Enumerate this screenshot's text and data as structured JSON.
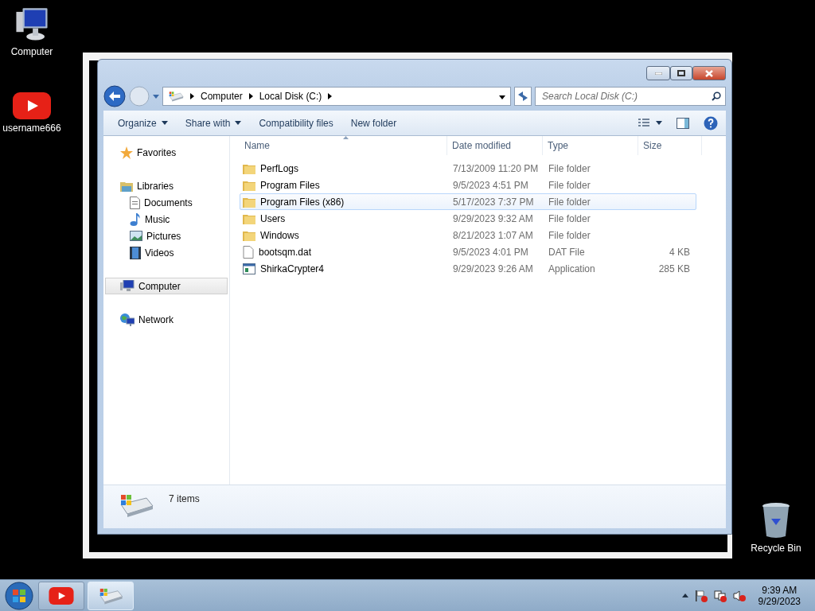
{
  "desktop_icons": [
    {
      "label": "Computer",
      "kind": "computer"
    },
    {
      "label": "username666",
      "kind": "youtube"
    },
    {
      "label": "Recycle Bin",
      "kind": "recycle"
    }
  ],
  "window": {
    "address": {
      "segments": [
        "Computer",
        "Local Disk (C:)"
      ]
    },
    "search": {
      "placeholder": "Search Local Disk (C:)"
    },
    "toolbar": [
      {
        "label": "Organize",
        "dropdown": true
      },
      {
        "label": "Share with",
        "dropdown": true
      },
      {
        "label": "Compatibility files",
        "dropdown": false
      },
      {
        "label": "New folder",
        "dropdown": false
      }
    ],
    "navigation": [
      {
        "label": "Favorites",
        "kind": "star",
        "selected": false
      },
      {
        "label": "Libraries",
        "kind": "library",
        "selected": false,
        "children": [
          {
            "label": "Documents",
            "kind": "document",
            "selected": false
          },
          {
            "label": "Music",
            "kind": "music",
            "selected": false
          },
          {
            "label": "Pictures",
            "kind": "pictures",
            "selected": false
          },
          {
            "label": "Videos",
            "kind": "videos",
            "selected": false
          }
        ]
      },
      {
        "label": "Computer",
        "kind": "computer",
        "selected": true
      },
      {
        "label": "Network",
        "kind": "network",
        "selected": false
      }
    ],
    "columns": [
      {
        "label": "Name",
        "sorted": true
      },
      {
        "label": "Date modified",
        "sorted": false
      },
      {
        "label": "Type",
        "sorted": false
      },
      {
        "label": "Size",
        "sorted": false
      }
    ],
    "rows": [
      {
        "name": "PerfLogs",
        "date": "7/13/2009 11:20 PM",
        "type": "File folder",
        "kind": "folder",
        "hovered": false
      },
      {
        "name": "Program Files",
        "date": "9/5/2023 4:51 PM",
        "type": "File folder",
        "kind": "folder",
        "hovered": false
      },
      {
        "name": "Program Files (x86)",
        "date": "5/17/2023 7:37 PM",
        "type": "File folder",
        "kind": "folder",
        "hovered": true
      },
      {
        "name": "Users",
        "date": "9/29/2023 9:32 AM",
        "type": "File folder",
        "kind": "folder",
        "hovered": false
      },
      {
        "name": "Windows",
        "date": "8/21/2023 1:07 AM",
        "type": "File folder",
        "kind": "folder",
        "hovered": false
      },
      {
        "name": "bootsqm.dat",
        "date": "9/5/2023 4:01 PM",
        "type": "DAT File",
        "size": "4 KB",
        "kind": "file",
        "hovered": false
      },
      {
        "name": "ShirkaCrypter4",
        "date": "9/29/2023 9:26 AM",
        "type": "Application",
        "size": "285 KB",
        "kind": "app",
        "hovered": false
      }
    ],
    "status": "7 items"
  },
  "taskbar": {
    "buttons": [
      {
        "kind": "youtube",
        "active": false
      },
      {
        "kind": "explorer",
        "active": true
      }
    ],
    "time": "9:39 AM",
    "date": "9/29/2023"
  }
}
